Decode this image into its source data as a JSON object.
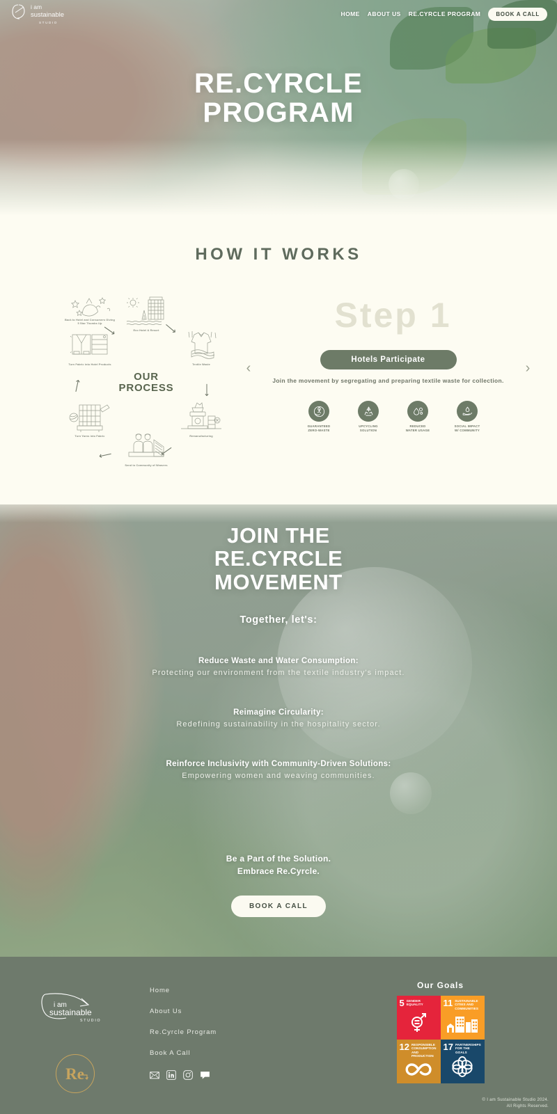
{
  "colors": {
    "cream": "#fdfcf2",
    "sage": "#6d7b67",
    "footer_bg": "#6e7a6c",
    "heading_green": "#5f6b5d",
    "step_ghost": "#e2e1d0",
    "gold": "#c7a45e"
  },
  "nav": {
    "logo_line1": "i am",
    "logo_line2": "sustainable",
    "logo_line3": "STUDIO",
    "links": [
      {
        "label": "HOME",
        "name": "nav-link-home"
      },
      {
        "label": "ABOUT US",
        "name": "nav-link-about-us"
      },
      {
        "label": "RE.CYRCLE PROGRAM",
        "name": "nav-link-recyrcle-program"
      }
    ],
    "cta": "BOOK A CALL"
  },
  "hero": {
    "title_line1": "RE.CYRCLE",
    "title_line2": "PROGRAM"
  },
  "how_it_works": {
    "title": "HOW IT WORKS",
    "process": {
      "center_line1": "OUR",
      "center_line2": "PROCESS",
      "nodes": [
        {
          "label": "Eco Hotel & Resort",
          "icon": "hotel-resort-icon"
        },
        {
          "label": "Textile Waste",
          "icon": "textile-waste-icon"
        },
        {
          "label": "Remanufacturing",
          "icon": "remanufacturing-icon"
        },
        {
          "label": "Send to Community of Weavers",
          "icon": "weavers-community-icon"
        },
        {
          "label": "Turn Yarns into Fabric",
          "icon": "yarn-to-fabric-icon"
        },
        {
          "label": "Turn Fabric into Hotel Products",
          "icon": "fabric-to-products-icon"
        },
        {
          "label": "Back to Hotel and Consumers Giving 5 Star Thumbs Up",
          "icon": "five-star-thumbs-up-icon"
        }
      ]
    },
    "step": {
      "number_label": "Step 1",
      "pill_label": "Hotels Participate",
      "description": "Join the movement by segregating and preparing textile waste for collection.",
      "prev_arrow": "‹",
      "next_arrow": "›"
    },
    "badges": [
      {
        "icon": "guaranteed-zero-waste-icon",
        "line1": "GUARANTEED",
        "line2": "ZERO-WASTE"
      },
      {
        "icon": "upcycling-solution-icon",
        "line1": "UPCYCLING",
        "line2": "SOLUTION"
      },
      {
        "icon": "reduced-water-usage-icon",
        "line1": "REDUCED",
        "line2": "WATER USAGE"
      },
      {
        "icon": "social-impact-icon",
        "line1": "SOCIAL IMPACT",
        "line2": "W/ COMMUNITY"
      }
    ]
  },
  "join": {
    "title_line1": "JOIN THE",
    "title_line2": "RE.CYRCLE",
    "title_line3": "MOVEMENT",
    "subtitle": "Together, let's:",
    "points": [
      {
        "heading": "Reduce Waste and Water Consumption:",
        "body": "Protecting our environment from the textile industry's impact."
      },
      {
        "heading": "Reimagine Circularity:",
        "body": "Redefining sustainability in the hospitality sector."
      },
      {
        "heading": "Reinforce Inclusivity with Community-Driven Solutions:",
        "body": "Empowering women and weaving communities."
      }
    ],
    "closing_line1": "Be a Part of the Solution.",
    "closing_line2": "Embrace Re.Cyrcle.",
    "cta": "BOOK A CALL"
  },
  "footer": {
    "logo_line1": "i am",
    "logo_line2": "sustainable",
    "logo_line3": "STUDIO",
    "re_badge_text": "Re",
    "links": [
      {
        "label": "Home",
        "name": "footer-link-home"
      },
      {
        "label": "About Us",
        "name": "footer-link-about-us"
      },
      {
        "label": "Re.Cyrcle Program",
        "name": "footer-link-recyrcle-program"
      },
      {
        "label": "Book A Call",
        "name": "footer-link-book-a-call"
      }
    ],
    "socials": [
      {
        "icon": "email-icon"
      },
      {
        "icon": "linkedin-icon"
      },
      {
        "icon": "instagram-icon"
      },
      {
        "icon": "chat-icon"
      }
    ],
    "goals_title": "Our Goals",
    "sdgs": [
      {
        "num": "5",
        "name": "GENDER EQUALITY",
        "art": "gender-equality-icon",
        "cls": "sdg5"
      },
      {
        "num": "11",
        "name": "SUSTAINABLE CITIES AND COMMUNITIES",
        "art": "sustainable-cities-icon",
        "cls": "sdg11"
      },
      {
        "num": "12",
        "name": "RESPONSIBLE CONSUMPTION AND PRODUCTION",
        "art": "infinity-icon",
        "cls": "sdg12"
      },
      {
        "num": "17",
        "name": "PARTNERSHIPS FOR THE GOALS",
        "art": "partnership-circles-icon",
        "cls": "sdg17"
      }
    ],
    "copyright_line1": "© I am Sustainable Studio 2024.",
    "copyright_line2": "All Rights Reserved."
  }
}
